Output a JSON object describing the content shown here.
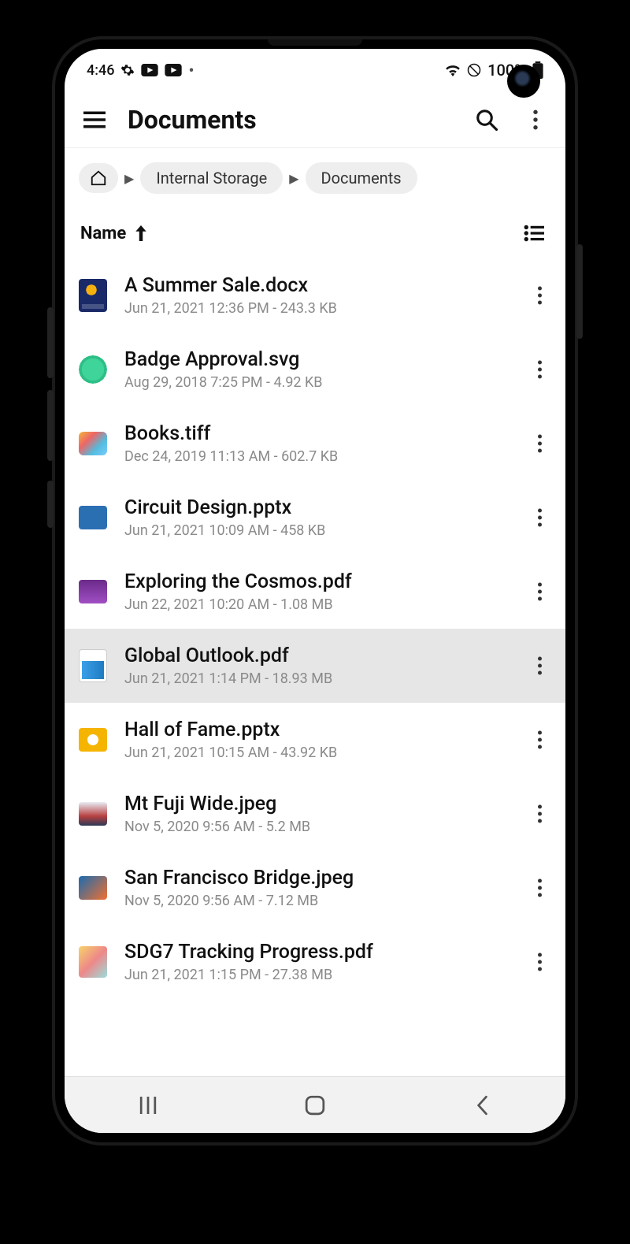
{
  "status": {
    "time": "4:46",
    "battery_text": "100%"
  },
  "appbar": {
    "title": "Documents"
  },
  "breadcrumb": {
    "items": [
      "Internal Storage",
      "Documents"
    ]
  },
  "sort": {
    "label": "Name"
  },
  "files": [
    {
      "name": "A Summer Sale.docx",
      "meta": "Jun 21, 2021 12:36 PM - 243.3 KB",
      "thumb": "t0",
      "selected": false
    },
    {
      "name": "Badge Approval.svg",
      "meta": "Aug 29, 2018 7:25 PM - 4.92 KB",
      "thumb": "t1",
      "selected": false
    },
    {
      "name": "Books.tiff",
      "meta": "Dec 24, 2019 11:13 AM - 602.7 KB",
      "thumb": "t2",
      "selected": false
    },
    {
      "name": "Circuit Design.pptx",
      "meta": "Jun 21, 2021 10:09 AM - 458 KB",
      "thumb": "t3",
      "selected": false
    },
    {
      "name": "Exploring the Cosmos.pdf",
      "meta": "Jun 22, 2021 10:20 AM - 1.08 MB",
      "thumb": "t4",
      "selected": false
    },
    {
      "name": "Global Outlook.pdf",
      "meta": "Jun 21, 2021 1:14 PM - 18.93 MB",
      "thumb": "t5",
      "selected": true
    },
    {
      "name": "Hall of Fame.pptx",
      "meta": "Jun 21, 2021 10:15 AM - 43.92 KB",
      "thumb": "t6",
      "selected": false
    },
    {
      "name": "Mt Fuji Wide.jpeg",
      "meta": "Nov 5, 2020 9:56 AM - 5.2 MB",
      "thumb": "t7",
      "selected": false
    },
    {
      "name": "San Francisco Bridge.jpeg",
      "meta": "Nov 5, 2020 9:56 AM - 7.12 MB",
      "thumb": "t8",
      "selected": false
    },
    {
      "name": "SDG7 Tracking Progress.pdf",
      "meta": "Jun 21, 2021 1:15 PM - 27.38 MB",
      "thumb": "t9",
      "selected": false
    }
  ]
}
